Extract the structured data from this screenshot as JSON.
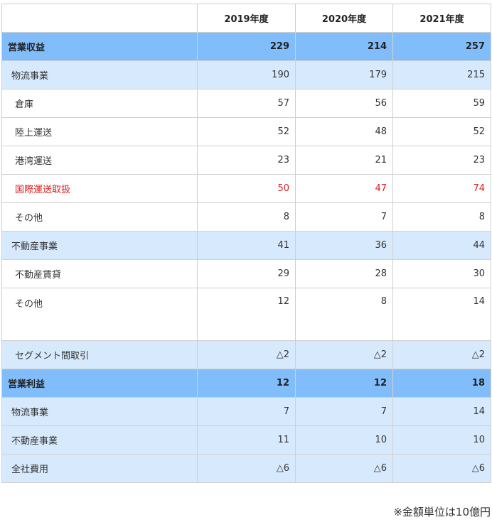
{
  "columns": [
    "",
    "2019年度",
    "2020年度",
    "2021年度"
  ],
  "rows": [
    {
      "label": "営業収益",
      "values": [
        "229",
        "214",
        "257"
      ],
      "style": "header"
    },
    {
      "label": "物流事業",
      "values": [
        "190",
        "179",
        "215"
      ],
      "style": "sub"
    },
    {
      "label": "倉庫",
      "values": [
        "57",
        "56",
        "59"
      ],
      "style": "plain"
    },
    {
      "label": "陸上運送",
      "values": [
        "52",
        "48",
        "52"
      ],
      "style": "plain"
    },
    {
      "label": "港湾運送",
      "values": [
        "23",
        "21",
        "23"
      ],
      "style": "plain"
    },
    {
      "label": "国際運送取扱",
      "values": [
        "50",
        "47",
        "74"
      ],
      "style": "plain-red"
    },
    {
      "label": "その他",
      "values": [
        "8",
        "7",
        "8"
      ],
      "style": "plain"
    },
    {
      "label": "不動産事業",
      "values": [
        "41",
        "36",
        "44"
      ],
      "style": "sub"
    },
    {
      "label": "不動産賃貸",
      "values": [
        "29",
        "28",
        "30"
      ],
      "style": "plain"
    },
    {
      "label": "その他",
      "values": [
        "12",
        "8",
        "14"
      ],
      "style": "plain-tall"
    },
    {
      "label": "セグメント間取引",
      "values": [
        "△2",
        "△2",
        "△2"
      ],
      "style": "sub"
    },
    {
      "label": "営業利益",
      "values": [
        "12",
        "12",
        "18"
      ],
      "style": "header"
    },
    {
      "label": "物流事業",
      "values": [
        "7",
        "7",
        "14"
      ],
      "style": "sub"
    },
    {
      "label": "不動産事業",
      "values": [
        "11",
        "10",
        "10"
      ],
      "style": "sub"
    },
    {
      "label": "全社費用",
      "values": [
        "△6",
        "△6",
        "△6"
      ],
      "style": "sub"
    }
  ],
  "note": "※金額単位は10億円",
  "colors": {
    "header": "#82bdfb",
    "sub": "#d7e9fc",
    "highlight_text": "#d62020"
  }
}
